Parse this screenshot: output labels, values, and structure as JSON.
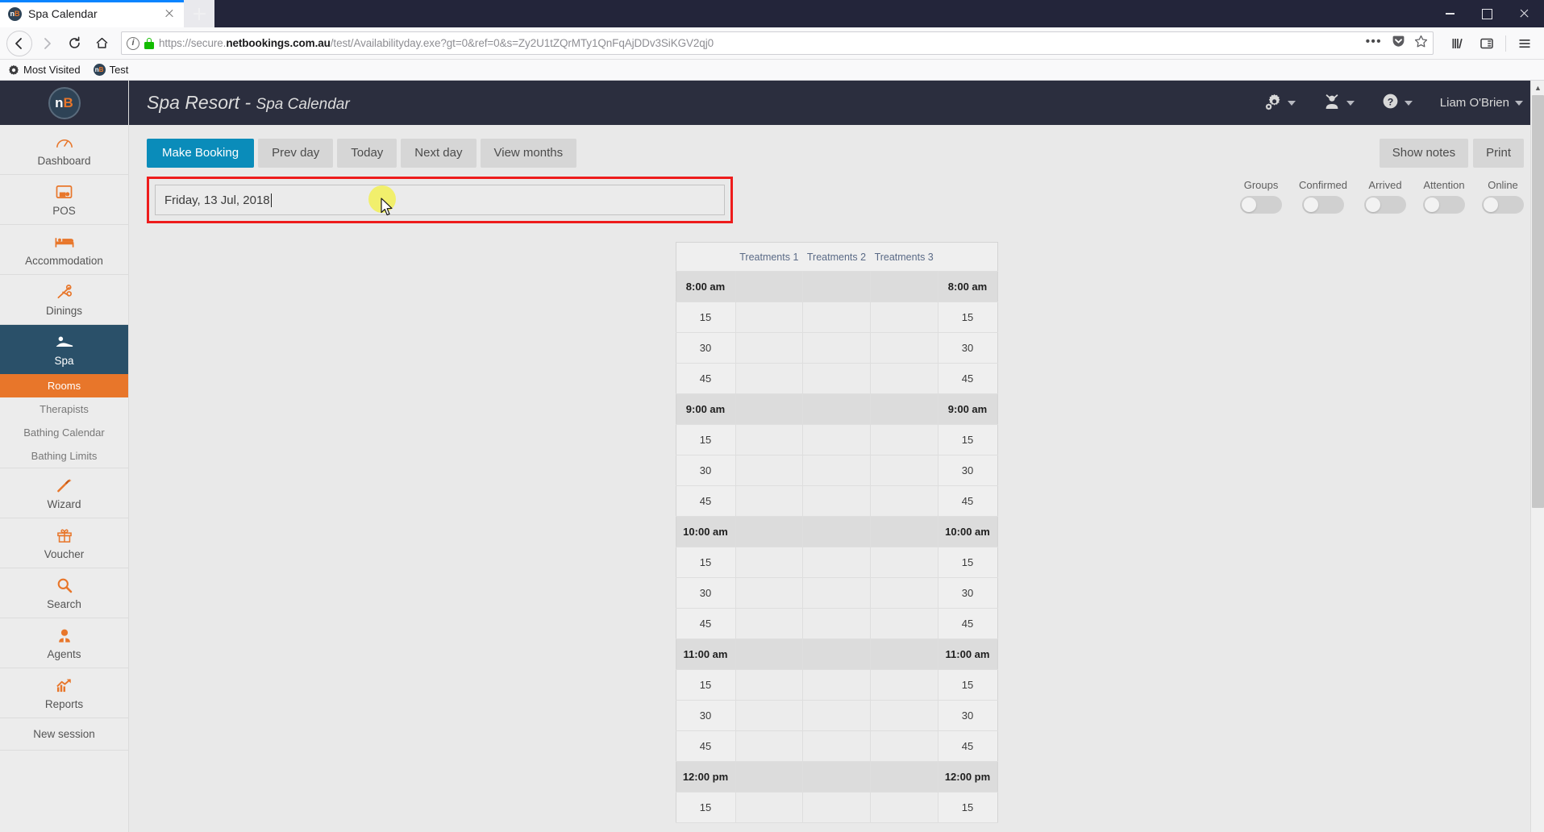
{
  "browser": {
    "tab": {
      "title": "Spa Calendar",
      "favicon": "nb-logo-icon"
    },
    "newtab_tooltip": "New Tab",
    "url": {
      "scheme": "https://",
      "prefix": "secure.",
      "host": "netbookings.com.au",
      "path": "/test/Availabilityday.exe?gt=0&ref=0&s=Zy2U1tZQrMTy1QnFqAjDDv3SiKGV2qj0",
      "full": "https://secure.netbookings.com.au/test/Availabilityday.exe?gt=0&ref=0&s=Zy2U1tZQrMTy1QnFqAjDDv3SiKGV2qj0"
    },
    "bookmarks": [
      {
        "label": "Most Visited",
        "icon": "star-gear-icon"
      },
      {
        "label": "Test",
        "icon": "nb-logo-icon"
      }
    ]
  },
  "header": {
    "logo": "nb-logo-icon",
    "title_main": "Spa Resort",
    "title_sep": " - ",
    "title_sub": "Spa Calendar",
    "gear_icon": "gear-icon",
    "user_icon": "user-headset-icon",
    "help_icon": "question-circle-icon",
    "user_name": "Liam O'Brien"
  },
  "sidebar": {
    "items": [
      {
        "label": "Dashboard",
        "icon": "gauge-icon",
        "active": false
      },
      {
        "label": "POS",
        "icon": "pos-terminal-icon",
        "active": false
      },
      {
        "label": "Accommodation",
        "icon": "bed-icon",
        "active": false
      },
      {
        "label": "Dinings",
        "icon": "cutlery-icon",
        "active": false
      },
      {
        "label": "Spa",
        "icon": "massage-icon",
        "active": true
      }
    ],
    "sub_items": [
      {
        "label": "Rooms",
        "active": true
      },
      {
        "label": "Therapists",
        "active": false
      },
      {
        "label": "Bathing Calendar",
        "active": false
      },
      {
        "label": "Bathing Limits",
        "active": false
      }
    ],
    "items2": [
      {
        "label": "Wizard",
        "icon": "magic-wand-icon"
      },
      {
        "label": "Voucher",
        "icon": "gift-icon"
      },
      {
        "label": "Search",
        "icon": "search-icon"
      },
      {
        "label": "Agents",
        "icon": "agent-person-icon"
      },
      {
        "label": "Reports",
        "icon": "chart-up-icon"
      }
    ],
    "new_session": "New session"
  },
  "toolbar": {
    "make_booking": "Make Booking",
    "prev_day": "Prev day",
    "today": "Today",
    "next_day": "Next day",
    "view_months": "View months",
    "show_notes": "Show notes",
    "print": "Print"
  },
  "date_field": {
    "value": "Friday, 13 Jul, 2018",
    "focused": true,
    "highlight_color": "#ee1c1c"
  },
  "toggles": [
    {
      "label": "Groups",
      "on": false
    },
    {
      "label": "Confirmed",
      "on": false
    },
    {
      "label": "Arrived",
      "on": false
    },
    {
      "label": "Attention",
      "on": false
    },
    {
      "label": "Online",
      "on": false
    }
  ],
  "calendar": {
    "columns": [
      "Treatments 1",
      "Treatments 2",
      "Treatments 3"
    ],
    "rows": [
      {
        "time": "8:00 am",
        "hour": true
      },
      {
        "time": "15",
        "hour": false
      },
      {
        "time": "30",
        "hour": false
      },
      {
        "time": "45",
        "hour": false
      },
      {
        "time": "9:00 am",
        "hour": true
      },
      {
        "time": "15",
        "hour": false
      },
      {
        "time": "30",
        "hour": false
      },
      {
        "time": "45",
        "hour": false
      },
      {
        "time": "10:00 am",
        "hour": true
      },
      {
        "time": "15",
        "hour": false
      },
      {
        "time": "30",
        "hour": false
      },
      {
        "time": "45",
        "hour": false
      },
      {
        "time": "11:00 am",
        "hour": true
      },
      {
        "time": "15",
        "hour": false
      },
      {
        "time": "30",
        "hour": false
      },
      {
        "time": "45",
        "hour": false
      },
      {
        "time": "12:00 pm",
        "hour": true
      },
      {
        "time": "15",
        "hour": false
      }
    ]
  },
  "colors": {
    "accent_orange": "#e8762a",
    "header_dark": "#2b2e3e",
    "active_blue": "#2a5069",
    "primary_button": "#0a8cba",
    "highlight_red": "#ee1c1c"
  }
}
